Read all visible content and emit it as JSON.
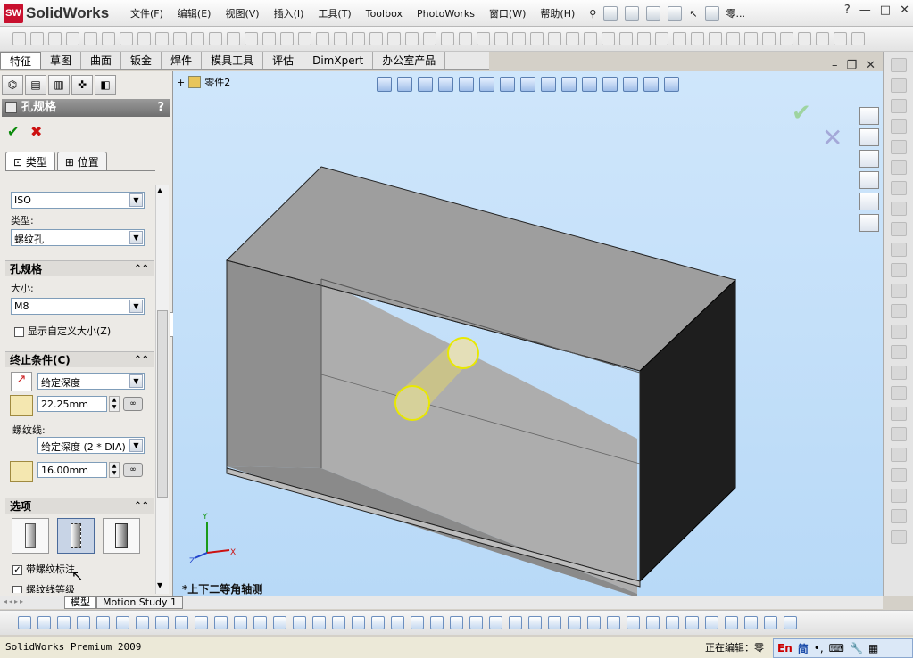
{
  "app": {
    "brand": "SolidWorks"
  },
  "menu": [
    "文件(F)",
    "编辑(E)",
    "视图(V)",
    "插入(I)",
    "工具(T)",
    "Toolbox",
    "PhotoWorks",
    "窗口(W)",
    "帮助(H)"
  ],
  "title_doc": "零...",
  "cmd_tabs": [
    "特征",
    "草图",
    "曲面",
    "钣金",
    "焊件",
    "模具工具",
    "评估",
    "DimXpert",
    "办公室产品"
  ],
  "property_manager": {
    "title": "孔规格",
    "help": "?",
    "subtabs": [
      "类型",
      "位置"
    ],
    "standard_value": "ISO",
    "type_label": "类型:",
    "type_value": "螺纹孔",
    "hole_spec_header": "孔规格",
    "size_label": "大小:",
    "size_value": "M8",
    "custom_size_label": "显示自定义大小(Z)",
    "end_condition_header": "终止条件(C)",
    "end_condition_value": "给定深度",
    "depth_value": "22.25mm",
    "thread_label": "螺纹线:",
    "thread_value": "给定深度 (2 * DIA)",
    "thread_depth_value": "16.00mm",
    "options_header": "选项",
    "cosmetic_thread_label": "带螺纹标注",
    "thread_class_label": "螺纹线等级"
  },
  "viewport": {
    "tree_label": "零件2",
    "view_label": "*上下二等角轴测"
  },
  "bottom_tabs": [
    "模型",
    "Motion Study 1"
  ],
  "status": {
    "left": "SolidWorks Premium 2009",
    "right": "正在编辑：零"
  },
  "ime": {
    "en": "En",
    "jian": "简"
  },
  "colors": {
    "viewport_bg": "#c4e0f9",
    "face_top": "#9c9c9c",
    "face_dark": "#1e1e1e",
    "hole_edge": "#e8e800"
  }
}
